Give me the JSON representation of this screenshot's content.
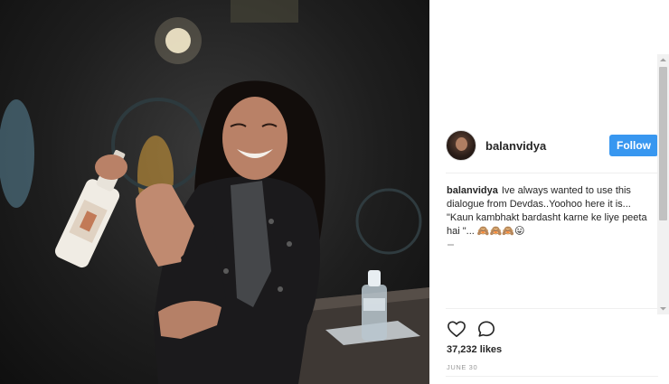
{
  "post": {
    "username": "balanvidya",
    "follow_label": "Follow",
    "caption_user": "balanvidya",
    "caption_text": "Ive always wanted to use this dialogue from Devdas..Yoohoo here it is... \"Kaun kambhakt bardasht karne ke liye peeta hai \"... 🙈🙈🙈😛",
    "likes": "37,232 likes",
    "date": "JUNE 30"
  },
  "icons": {
    "like": "heart-icon",
    "comment": "comment-icon"
  },
  "colors": {
    "follow_button": "#3897f0",
    "text": "#262626",
    "muted": "#999999"
  }
}
